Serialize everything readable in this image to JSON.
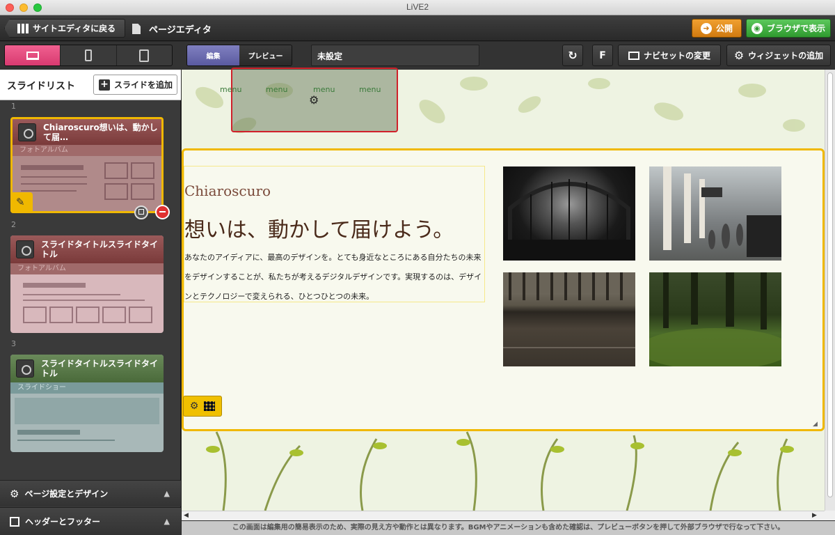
{
  "window": {
    "title": "LiVE2"
  },
  "toolbar": {
    "back_label": "サイトエディタに戻る",
    "page_editor_label": "ページエディタ",
    "publish_label": "公開",
    "browser_label": "ブラウザで表示"
  },
  "toolbar2": {
    "mode_edit": "編集",
    "mode_preview": "プレビュー",
    "unset_value": "未設定",
    "f_label": "F",
    "navset_label": "ナビセットの変更",
    "widget_label": "ウィジェットの追加"
  },
  "sidebar": {
    "title": "スライドリスト",
    "add_slide_label": "スライドを追加",
    "slides": [
      {
        "num": "1",
        "title": "Chiaroscuro想いは、動かして届…",
        "type": "フォトアルバム"
      },
      {
        "num": "2",
        "title": "スライドタイトルスライドタイトル",
        "type": "フォトアルバム"
      },
      {
        "num": "3",
        "title": "スライドタイトルスライドタイトル",
        "type": "スライドショー"
      }
    ],
    "page_settings_label": "ページ設定とデザイン",
    "header_footer_label": "ヘッダーとフッター"
  },
  "canvas": {
    "menu_items": [
      "menu",
      "menu",
      "menu",
      "menu"
    ],
    "slide_title": "Chiaroscuro",
    "heading": "想いは、動かして届けよう。",
    "body": "あなたのアイディアに、最高のデザインを。とても身近なところにある自分たちの未来をデザインすることが、私たちが考えるデジタルデザインです。実現するのは、デザインとテクノロジーで変えられる、ひとつひとつの未来。"
  },
  "notice": "この画面は編集用の簡易表示のため、実際の見え方や動作とは異なります。BGMやアニメーションも含めた確認は、プレビューボタンを押して外部ブラウザで行なって下さい。",
  "colors": {
    "accent_pink": "#e84a80",
    "publish_orange": "#e08a20",
    "browser_green": "#3aa83a",
    "edit_purple": "#6a6ab0",
    "selection_yellow": "#f0b800",
    "slide_brown": "#8a4a4a",
    "slide_green": "#5a7a4a"
  }
}
